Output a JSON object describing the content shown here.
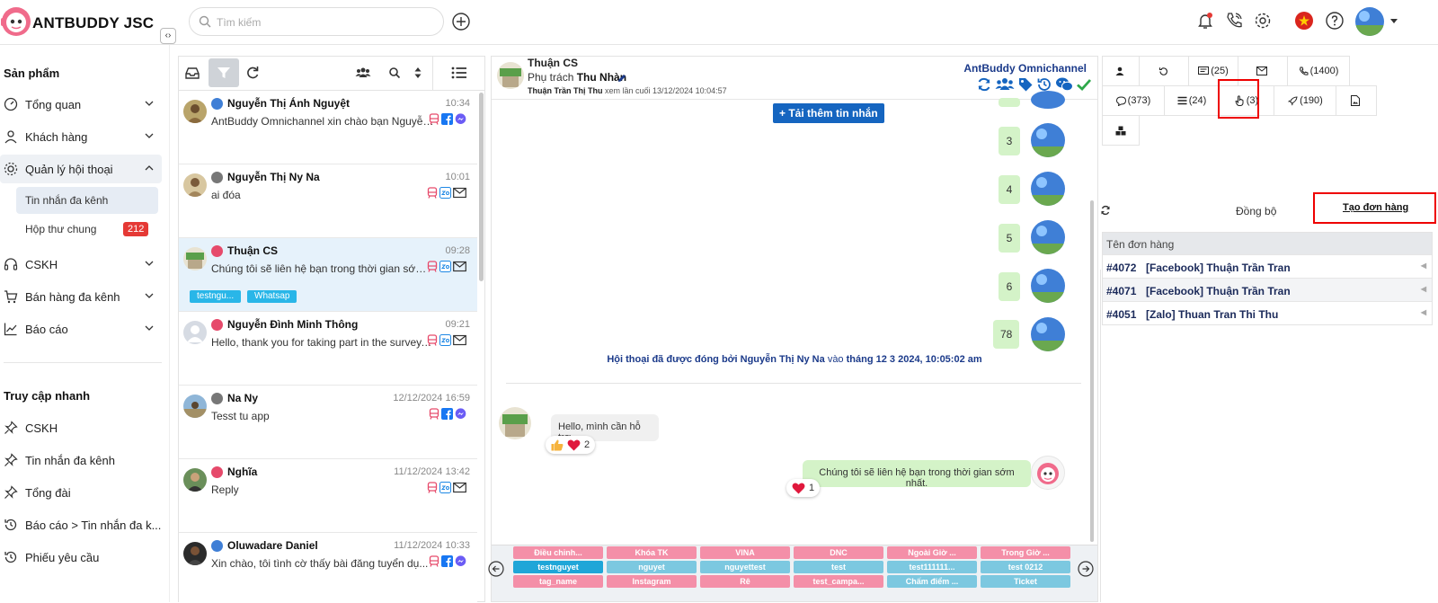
{
  "app": {
    "brand": "ANTBUDDY JSC"
  },
  "search": {
    "placeholder": "Tìm kiếm"
  },
  "sidebar": {
    "section_products": "Sản phẩm",
    "items": [
      {
        "label": "Tổng quan"
      },
      {
        "label": "Khách hàng"
      },
      {
        "label": "Quản lý hội thoại"
      },
      {
        "label": "CSKH"
      },
      {
        "label": "Bán hàng đa kênh"
      },
      {
        "label": "Báo cáo"
      }
    ],
    "sub_items": [
      {
        "label": "Tin nhắn đa kênh"
      },
      {
        "label": "Hộp thư chung",
        "badge": "212"
      }
    ],
    "section_quick": "Truy cập nhanh",
    "quick_items": [
      {
        "label": "CSKH"
      },
      {
        "label": "Tin nhắn đa kênh"
      },
      {
        "label": "Tổng đài"
      },
      {
        "label": "Báo cáo > Tin nhắn đa k..."
      },
      {
        "label": "Phiếu yêu cầu"
      }
    ]
  },
  "conversations": [
    {
      "name": "Nguyễn Thị Ánh Nguyệt",
      "time": "10:34",
      "preview": "AntBuddy Omnichannel xin chào bạn Nguyễn Thị ...",
      "channels": [
        "bus",
        "fb",
        "msg"
      ]
    },
    {
      "name": "Nguyễn Thị Ny Na",
      "time": "10:01",
      "preview": "ai đóa",
      "channels": [
        "bus",
        "zalo",
        "mail"
      ]
    },
    {
      "name": "Thuận CS",
      "time": "09:28",
      "preview": "Chúng tôi sẽ liên hệ bạn trong thời gian sớm nhất.",
      "channels": [
        "bus",
        "zalo",
        "mail"
      ],
      "tags": [
        "testngu...",
        "Whatsap"
      ]
    },
    {
      "name": "Nguyễn Đình Minh Thông",
      "time": "09:21",
      "preview": "Hello, thank you for taking part in the survey. How...",
      "channels": [
        "bus",
        "zalo",
        "mail"
      ]
    },
    {
      "name": "Na Ny",
      "time": "12/12/2024 16:59",
      "preview": "Tesst tu app",
      "channels": [
        "bus",
        "fb",
        "msg"
      ]
    },
    {
      "name": "Nghĩa",
      "time": "11/12/2024 13:42",
      "preview": "Reply",
      "channels": [
        "bus",
        "zalo",
        "mail"
      ]
    },
    {
      "name": "Oluwadare Daniel",
      "time": "11/12/2024 10:33",
      "preview": "Xin chào, tôi tình cờ thấy bài đăng tuyển dụ...",
      "channels": [
        "bus",
        "fb",
        "msg"
      ]
    }
  ],
  "chat": {
    "name": "Thuận CS",
    "assign_prefix": "Phụ trách",
    "assignee": "Thu Nhàn",
    "seen_by": "Thuận Trần Thị Thu",
    "seen_text": "xem lần cuối 13/12/2024 10:04:57",
    "omni": "AntBuddy Omnichannel",
    "load_more": "Tải thêm tin nhắn",
    "number_messages": [
      "3",
      "4",
      "5",
      "6",
      "78"
    ],
    "closed_by_prefix": "Hội thoại đã được đóng bởi",
    "closed_by": "Nguyễn Thị Ny Na",
    "closed_at_word": "vào",
    "closed_at": "tháng 12 3 2024, 10:05:02 am",
    "incoming": "Hello, mình cần hỗ trợ",
    "incoming_reaction_count": "2",
    "outgoing": "Chúng tôi sẽ liên hệ bạn trong thời gian sớm nhất.",
    "outgoing_reaction_count": "1"
  },
  "quick_tags": [
    {
      "label": "Điều chỉnh...",
      "color": "pink"
    },
    {
      "label": "Khóa TK",
      "color": "pink"
    },
    {
      "label": "VINA",
      "color": "pink"
    },
    {
      "label": "DNC",
      "color": "pink"
    },
    {
      "label": "Ngoài Giờ ...",
      "color": "pink"
    },
    {
      "label": "Trong Giờ ...",
      "color": "pink"
    },
    {
      "label": "testnguyet",
      "color": "dark"
    },
    {
      "label": "nguyet",
      "color": "blue"
    },
    {
      "label": "nguyettest",
      "color": "blue"
    },
    {
      "label": "test",
      "color": "blue"
    },
    {
      "label": "test111111...",
      "color": "blue"
    },
    {
      "label": "test 0212",
      "color": "blue"
    },
    {
      "label": "tag_name",
      "color": "pink"
    },
    {
      "label": "Instagram",
      "color": "pink"
    },
    {
      "label": "Rê",
      "color": "pink"
    },
    {
      "label": "test_campa...",
      "color": "pink"
    },
    {
      "label": "Chấm điểm ...",
      "color": "blue"
    },
    {
      "label": "Ticket",
      "color": "blue"
    }
  ],
  "right_panel": {
    "tabs_row1": [
      "",
      "",
      "(25)",
      "",
      "(1400)"
    ],
    "tabs_row2": [
      "(373)",
      "(24)",
      "(3)",
      "(190)",
      ""
    ],
    "sync_label": "Đồng bộ",
    "create_order": "Tạo đơn hàng",
    "orders_header": "Tên đơn hàng",
    "orders": [
      {
        "id": "#4072",
        "name": "[Facebook] Thuận Trần Tran"
      },
      {
        "id": "#4071",
        "name": "[Facebook] Thuận Trần Tran"
      },
      {
        "id": "#4051",
        "name": "[Zalo] Thuan Tran Thi Thu"
      }
    ]
  },
  "colors": {
    "accent": "#1565c0",
    "badge": "#e53935",
    "highlight": "#ee0000"
  }
}
